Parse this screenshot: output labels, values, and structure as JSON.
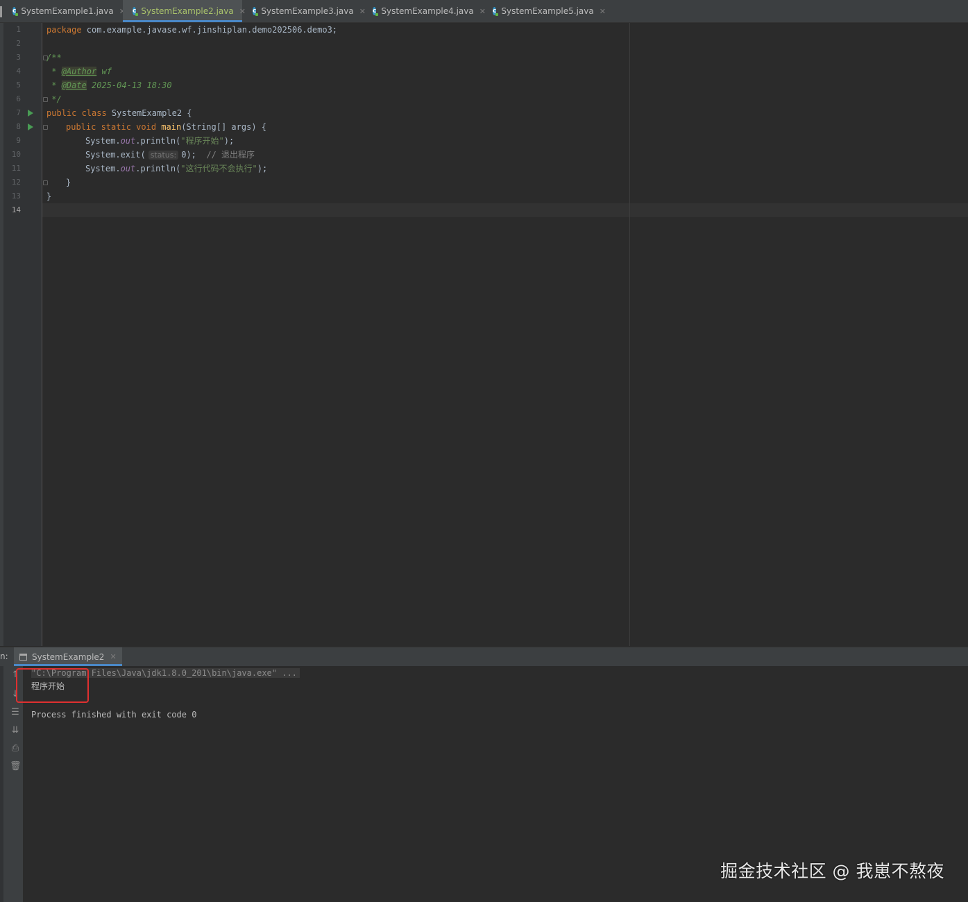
{
  "tabs": [
    {
      "label": "SystemExample1.java",
      "icon": "java-class-icon",
      "active": false
    },
    {
      "label": "SystemExample2.java",
      "icon": "java-class-icon",
      "active": true
    },
    {
      "label": "SystemExample3.java",
      "icon": "java-class-icon",
      "active": false
    },
    {
      "label": "SystemExample4.java",
      "icon": "java-class-icon",
      "active": false
    },
    {
      "label": "SystemExample5.java",
      "icon": "java-class-icon",
      "active": false
    }
  ],
  "editor": {
    "line_numbers": [
      "1",
      "2",
      "3",
      "4",
      "5",
      "6",
      "7",
      "8",
      "9",
      "10",
      "11",
      "12",
      "13",
      "14"
    ],
    "current_line": "14",
    "code": {
      "l1_kw": "package",
      "l1_rest": " com.example.javase.wf.jinshiplan.demo202506.demo3;",
      "l3": "/**",
      "l4_star": " * ",
      "l4_tag": "@Author",
      "l4_val": " wf",
      "l5_star": " * ",
      "l5_tag": "@Date",
      "l5_val": " 2025-04-13 18:30",
      "l6": " */",
      "l7_kw": "public class",
      "l7_rest": " SystemExample2 {",
      "l8_kw": "public static void",
      "l8_fn": "main",
      "l8_rest": "(String[] args) {",
      "l9_a": "System.",
      "l9_fld": "out",
      "l9_b": ".println(",
      "l9_str": "\"程序开始\"",
      "l9_c": ");",
      "l10_a": "System.exit(",
      "l10_hint": "status:",
      "l10_b": "0);",
      "l10_cmt": "// 退出程序",
      "l11_a": "System.",
      "l11_fld": "out",
      "l11_b": ".println(",
      "l11_str": "\"这行代码不会执行\"",
      "l11_c": ");",
      "l12": "}",
      "l13": "}"
    }
  },
  "run": {
    "prefix": "n:",
    "tab_label": "SystemExample2",
    "toolbar_icons": [
      "up-arrow-icon",
      "down-arrow-icon",
      "soft-wrap-icon",
      "scroll-to-end-icon",
      "print-icon",
      "trash-icon"
    ],
    "cmd": "\"C:\\Program Files\\Java\\jdk1.8.0_201\\bin\\java.exe\" ...",
    "output": "程序开始",
    "exit": "Process finished with exit code 0"
  },
  "colors": {
    "accent": "#4a88c7",
    "keyword": "#cc7832",
    "string": "#6a8759",
    "highlight_box": "#e03030"
  },
  "watermark": "掘金技术社区 @ 我崽不熬夜"
}
